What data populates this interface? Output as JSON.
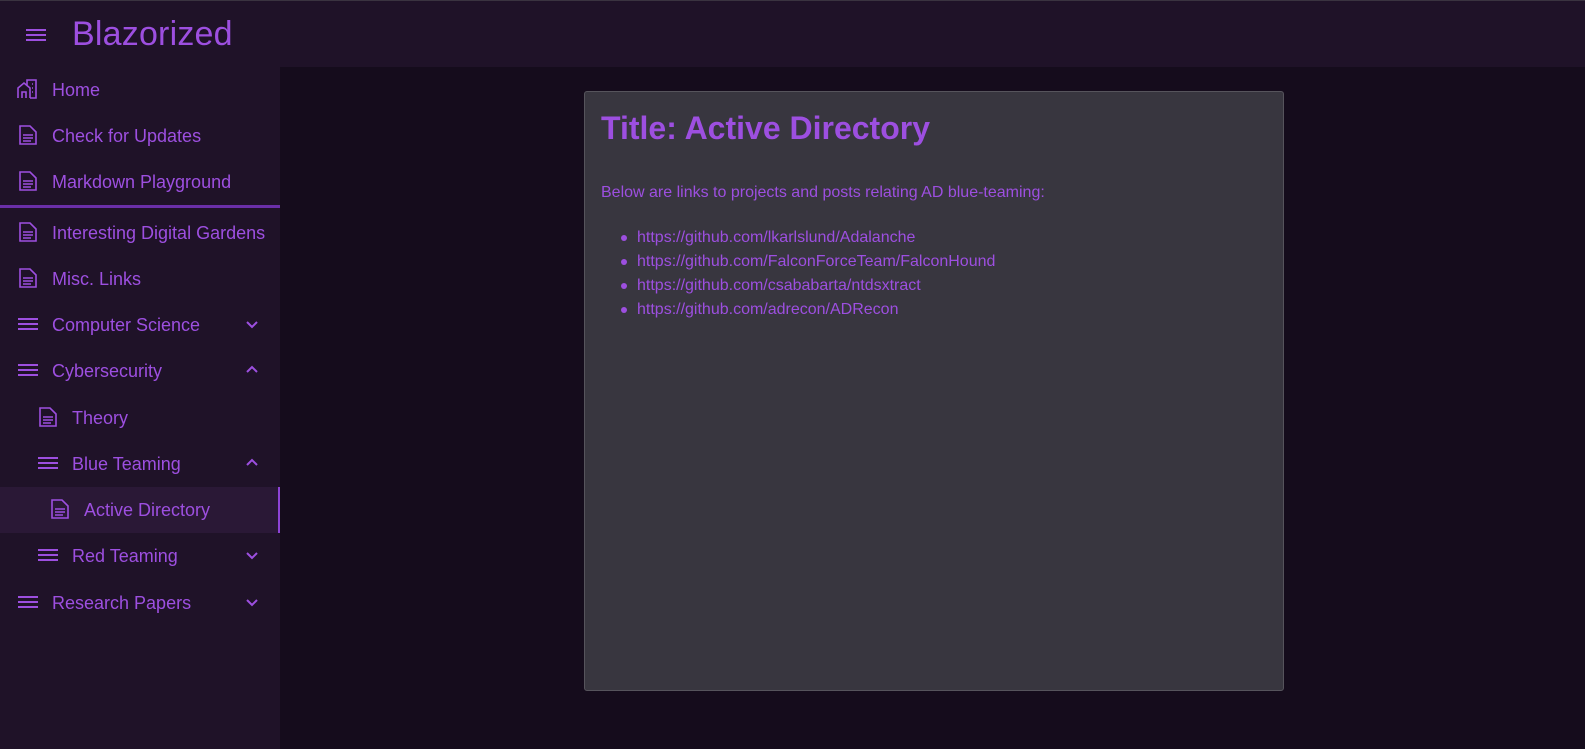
{
  "app": {
    "title": "Blazorized",
    "accent_color": "#9d4fe0",
    "background_color": "#150c1c",
    "sidebar_color": "#1f1228"
  },
  "sidebar": {
    "items": [
      {
        "label": "Home",
        "icon": "home-icon",
        "chevron": null
      },
      {
        "label": "Check for Updates",
        "icon": "document-icon",
        "chevron": null
      },
      {
        "label": "Markdown Playground",
        "icon": "document-icon",
        "chevron": null
      },
      {
        "label": "Interesting Digital Gardens",
        "icon": "document-icon",
        "chevron": null
      },
      {
        "label": "Misc. Links",
        "icon": "document-icon",
        "chevron": null
      },
      {
        "label": "Computer Science",
        "icon": "list-icon",
        "chevron": "chevron-down-icon"
      },
      {
        "label": "Cybersecurity",
        "icon": "list-icon",
        "chevron": "chevron-up-icon"
      },
      {
        "label": "Theory",
        "icon": "document-icon",
        "chevron": null
      },
      {
        "label": "Blue Teaming",
        "icon": "list-icon",
        "chevron": "chevron-up-icon"
      },
      {
        "label": "Active Directory",
        "icon": "document-icon",
        "chevron": null,
        "active": true
      },
      {
        "label": "Red Teaming",
        "icon": "list-icon",
        "chevron": "chevron-down-icon"
      },
      {
        "label": "Research Papers",
        "icon": "list-icon",
        "chevron": "chevron-down-icon"
      }
    ]
  },
  "main": {
    "title": "Title: Active Directory",
    "intro": "Below are links to projects and posts relating AD blue-teaming:",
    "links": [
      "https://github.com/lkarlslund/Adalanche",
      "https://github.com/FalconForceTeam/FalconHound",
      "https://github.com/csababarta/ntdsxtract",
      "https://github.com/adrecon/ADRecon"
    ]
  }
}
